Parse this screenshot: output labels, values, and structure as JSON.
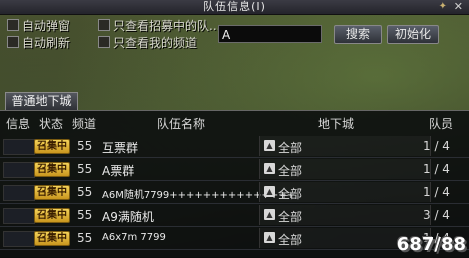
{
  "window": {
    "title": "队伍信息(I)",
    "pin_icon": "pin-icon",
    "close_icon": "close-icon"
  },
  "filters": {
    "auto_popup": "自动弹窗",
    "auto_refresh": "自动刷新",
    "only_recruiting": "只查看招募中的队...",
    "only_my_channel": "只查看我的频道"
  },
  "search": {
    "value": "A",
    "search_label": "搜索",
    "reset_label": "初始化"
  },
  "tabs": [
    {
      "label": "普通地下城"
    }
  ],
  "table": {
    "headers": {
      "info": "信息",
      "status": "状态",
      "channel": "频道",
      "team_name": "队伍名称",
      "dungeon": "地下城",
      "members": "队员"
    },
    "rows": [
      {
        "status": "召集中",
        "channel": "55",
        "name": "互票群",
        "dungeon": "全部",
        "members": "1 / 4"
      },
      {
        "status": "召集中",
        "channel": "55",
        "name": "A票群",
        "dungeon": "全部",
        "members": "1 / 4"
      },
      {
        "status": "召集中",
        "channel": "55",
        "name": "A6M随机7799+++++++++++++++",
        "dungeon": "全部",
        "members": "1 / 4"
      },
      {
        "status": "召集中",
        "channel": "55",
        "name": "A9满随机",
        "dungeon": "全部",
        "members": "3 / 4"
      },
      {
        "status": "召集中",
        "channel": "55",
        "name": "A6x7m 7799",
        "dungeon": "全部",
        "members": "1 / 4"
      }
    ]
  },
  "watermark": "687/88"
}
